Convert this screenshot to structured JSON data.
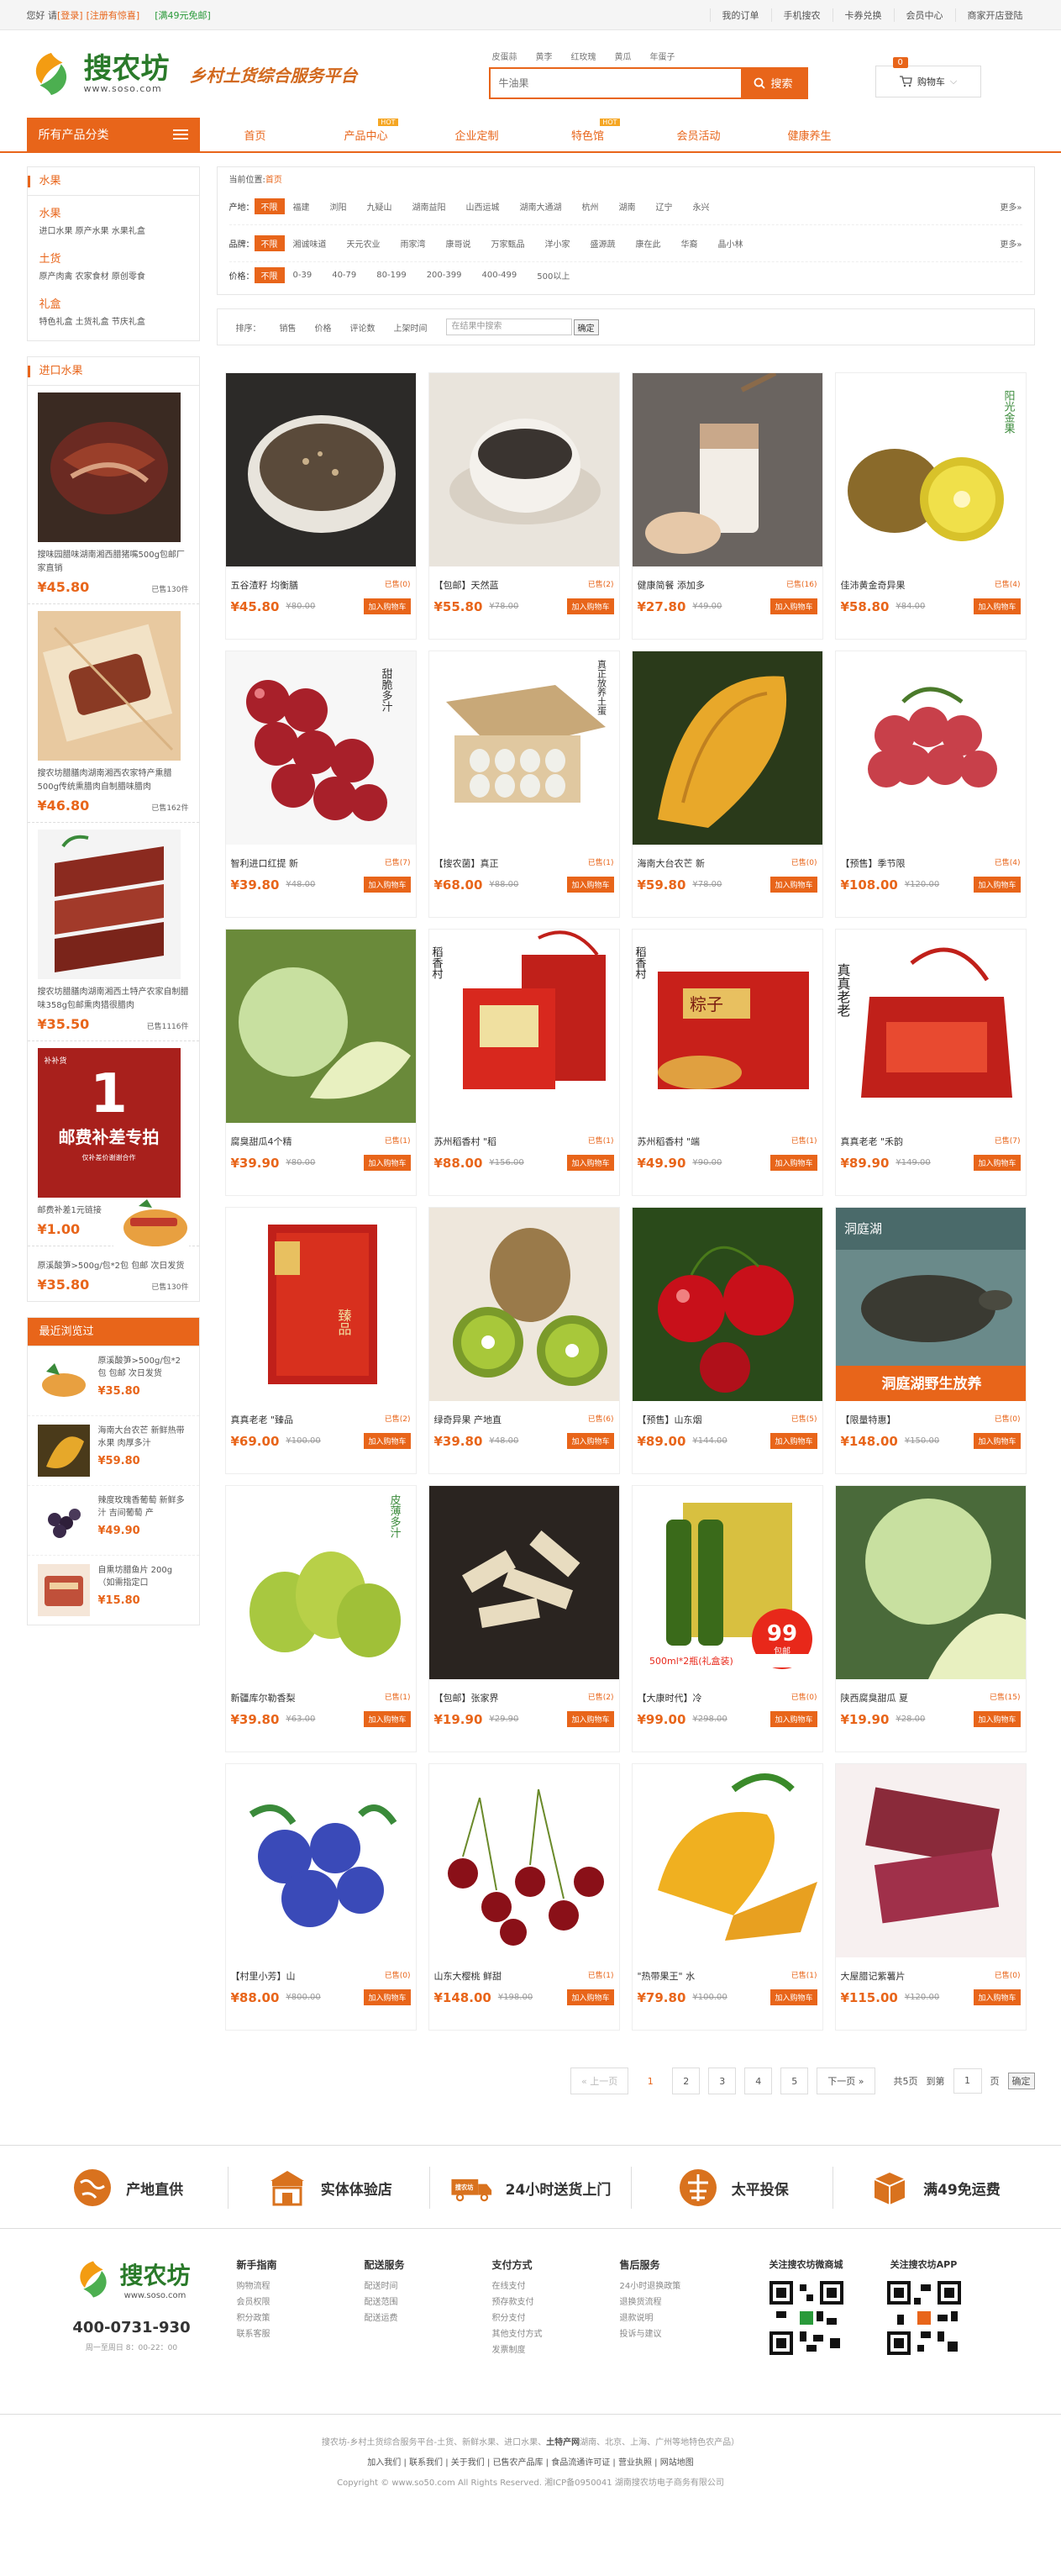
{
  "topbar": {
    "greet": "您好 请",
    "login": "[登录]",
    "reg": "[注册有惊喜]",
    "promo": "[满49元免邮]",
    "links": [
      "我的订单",
      "手机搜农",
      "卡券兑换",
      "会员中心",
      "商家开店登陆"
    ]
  },
  "header": {
    "logo_name": "搜农坊",
    "logo_url": "www.soso.com",
    "slogan": "乡村土货综合服务平台",
    "hot": [
      "皮蛋蒜",
      "黄李",
      "红玫瑰",
      "黄瓜",
      "年蛋子"
    ],
    "search_placeholder": "牛油果",
    "search_btn": "搜索",
    "cart_label": "购物车",
    "cart_count": "0"
  },
  "nav": {
    "cat_head": "所有产品分类",
    "items": [
      {
        "label": "首页",
        "tag": ""
      },
      {
        "label": "产品中心",
        "tag": "HOT"
      },
      {
        "label": "企业定制",
        "tag": ""
      },
      {
        "label": "特色馆",
        "tag": "HOT"
      },
      {
        "label": "会员活动",
        "tag": ""
      },
      {
        "label": "健康养生",
        "tag": ""
      }
    ]
  },
  "side": {
    "cat_title": "水果",
    "groups": [
      {
        "title": "水果",
        "items": "进口水果 原产水果 水果礼盒"
      },
      {
        "title": "土货",
        "items": "原产肉禽 农家食材 原创零食"
      },
      {
        "title": "礼盒",
        "items": "特色礼盒 土货礼盒 节庆礼盒"
      }
    ],
    "imp_title": "进口水果",
    "imp": [
      {
        "name": "搜味园腊味湖南湘西腊猪嘴500g包邮厂家直销",
        "price": "¥45.80",
        "sold": "已售",
        "sold_n": "130件"
      },
      {
        "name": "搜农坊腊膳肉湖南湘西农家特产熏腊500g传统熏腊肉自制腊味腊肉",
        "price": "¥46.80",
        "sold": "已售",
        "sold_n": "162件"
      },
      {
        "name": "搜农坊腊膳肉湖南湘西土特产农家自制腊味358g包邮熏肉猎很腊肉",
        "price": "¥35.50",
        "sold": "已售",
        "sold_n": "1116件"
      },
      {
        "name": "邮费补差1元链接",
        "price": "¥1.00",
        "sold": "",
        "sold_n": ""
      },
      {
        "name": "原溪酸笋>500g/包*2包 包邮 次日发货",
        "price": "¥35.80",
        "sold": "已售",
        "sold_n": "130件"
      }
    ],
    "imp_banner": {
      "big": "1",
      "line": "邮费补差专拍",
      "tag": "补补货",
      "sub": "仅补差价谢谢合作"
    },
    "recent_title": "最近浏览过",
    "recent": [
      {
        "name": "原溪酸笋>500g/包*2包 包邮 次日发货",
        "price": "¥35.80"
      },
      {
        "name": "海南大台农芒 新鲜热带水果 肉厚多汁",
        "price": "¥59.80"
      },
      {
        "name": "辣度玫瑰香葡萄 新鲜多汁 吉间葡萄 产",
        "price": "¥49.90"
      },
      {
        "name": "自熏坊腊鱼片 200g（如需指定口",
        "price": "¥15.80"
      }
    ]
  },
  "filter": {
    "bc_label": "当前位置:",
    "bc_home": "首页",
    "rows": [
      {
        "label": "产地：",
        "all": "不限",
        "opts": [
          "福建",
          "浏阳",
          "九疑山",
          "湖南益阳",
          "山西运城",
          "湖南大通湖",
          "杭州",
          "湖南",
          "辽宁",
          "永兴"
        ],
        "more": "更多»"
      },
      {
        "label": "品牌：",
        "all": "不限",
        "opts": [
          "湘诚味道",
          "天元农业",
          "雨家湾",
          "康哥说",
          "万家甄品",
          "洋小家",
          "盛源蔬",
          "康在此",
          "华裔",
          "晶小林"
        ],
        "more": "更多»"
      },
      {
        "label": "价格：",
        "all": "不限",
        "opts": [
          "0-39",
          "40-79",
          "80-199",
          "200-399",
          "400-499",
          "500以上"
        ],
        "more": ""
      }
    ]
  },
  "sort": {
    "label": "排序：",
    "opts": [
      "销售",
      "价格",
      "评论数",
      "上架时间"
    ],
    "placeholder": "在结果中搜索",
    "btn": "确定"
  },
  "products": [
    {
      "name": "五谷渣籽 均衡膳",
      "sold": "已售",
      "n": "(0)",
      "price": "¥45.80",
      "old": "¥80.00",
      "img": "porridge"
    },
    {
      "name": "【包邮】天然蓝",
      "sold": "已售",
      "n": "(2)",
      "price": "¥55.80",
      "old": "¥78.00",
      "img": "paste"
    },
    {
      "name": "健康简餐 添加多",
      "sold": "已售",
      "n": "(16)",
      "price": "¥27.80",
      "old": "¥49.00",
      "img": "yogurt"
    },
    {
      "name": "佳沛黄金奇异果",
      "sold": "已售",
      "n": "(4)",
      "price": "¥58.80",
      "old": "¥84.00",
      "img": "kiwi-gold"
    },
    {
      "name": "智利进口红提 新",
      "sold": "已售",
      "n": "(7)",
      "price": "¥39.80",
      "old": "¥48.00",
      "img": "grapes"
    },
    {
      "name": "【搜农菌】真正",
      "sold": "已售",
      "n": "(1)",
      "price": "¥68.00",
      "old": "¥88.00",
      "img": "eggs"
    },
    {
      "name": "海南大台农芒 新",
      "sold": "已售",
      "n": "(0)",
      "price": "¥59.80",
      "old": "¥78.00",
      "img": "mango"
    },
    {
      "name": "【预售】季节限",
      "sold": "已售",
      "n": "(4)",
      "price": "¥108.00",
      "old": "¥120.00",
      "img": "lychee"
    },
    {
      "name": "腐臭甜瓜4个精",
      "sold": "已售",
      "n": "(1)",
      "price": "¥39.90",
      "old": "¥80.00",
      "img": "melon"
    },
    {
      "name": "苏州稻香村 \"稻",
      "sold": "已售",
      "n": "(1)",
      "price": "¥88.00",
      "old": "¥156.00",
      "img": "giftbox1"
    },
    {
      "name": "苏州稻香村 \"端",
      "sold": "已售",
      "n": "(1)",
      "price": "¥49.90",
      "old": "¥90.00",
      "img": "giftbox2"
    },
    {
      "name": "真真老老 \"禾韵",
      "sold": "已售",
      "n": "(7)",
      "price": "¥89.90",
      "old": "¥149.00",
      "img": "giftbag"
    },
    {
      "name": "真真老老 \"臻品",
      "sold": "已售",
      "n": "(2)",
      "price": "¥69.00",
      "old": "¥100.00",
      "img": "giftbox3"
    },
    {
      "name": "绿奇异果 产地直",
      "sold": "已售",
      "n": "(6)",
      "price": "¥39.80",
      "old": "¥48.00",
      "img": "kiwi-green"
    },
    {
      "name": "【预售】山东烟",
      "sold": "已售",
      "n": "(5)",
      "price": "¥89.00",
      "old": "¥144.00",
      "img": "cherry"
    },
    {
      "name": "【限量特惠】",
      "sold": "已售",
      "n": "(0)",
      "price": "¥148.00",
      "old": "¥150.00",
      "img": "turtle"
    },
    {
      "name": "新疆库尔勒香梨",
      "sold": "已售",
      "n": "(1)",
      "price": "¥39.80",
      "old": "¥63.00",
      "img": "pear"
    },
    {
      "name": "【包邮】张家界",
      "sold": "已售",
      "n": "(2)",
      "price": "¥19.90",
      "old": "¥29.90",
      "img": "bamboo"
    },
    {
      "name": "【大康时代】冷",
      "sold": "已售",
      "n": "(0)",
      "price": "¥99.00",
      "old": "¥298.00",
      "img": "oil"
    },
    {
      "name": "陕西腐臭甜瓜 夏",
      "sold": "已售",
      "n": "(15)",
      "price": "¥19.90",
      "old": "¥28.00",
      "img": "melon2"
    },
    {
      "name": "【村里小芳】山",
      "sold": "已售",
      "n": "(0)",
      "price": "¥88.00",
      "old": "¥800.00",
      "img": "blueberry"
    },
    {
      "name": "山东大樱桃 鲜甜",
      "sold": "已售",
      "n": "(1)",
      "price": "¥148.00",
      "old": "¥198.00",
      "img": "cherry2"
    },
    {
      "name": "\"热带果王\" 水",
      "sold": "已售",
      "n": "(1)",
      "price": "¥79.80",
      "old": "¥100.00",
      "img": "mango2"
    },
    {
      "name": "大屋腊记紫薯片",
      "sold": "已售",
      "n": "(0)",
      "price": "¥115.00",
      "old": "¥120.00",
      "img": "jerky"
    }
  ],
  "card_add": "加入购物车",
  "img_text": {
    "kiwi_gold": "阳光金果",
    "grapes": "甜脆多汁",
    "eggs": "真正放养土蛋",
    "giftbox": "稻香村",
    "giftbox_zi": "粽子",
    "giftbag": "真真老老",
    "giftbox3": "臻品",
    "pear": "皮薄多汁",
    "oil": "500ml*2瓶(礼盒装)",
    "oil_badge": "99",
    "oil_badge_sub": "包邮",
    "turtle_top": "洞庭湖",
    "turtle": "洞庭湖野生放养"
  },
  "pager": {
    "prev": "« 上一页",
    "pages": [
      "1",
      "2",
      "3",
      "4",
      "5"
    ],
    "next": "下一页 »",
    "total": "共5页",
    "goto": "到第",
    "page_val": "1",
    "unit": "页",
    "ok": "确定"
  },
  "service": [
    "产地直供",
    "实体体验店",
    "24小时送货上门",
    "太平投保",
    "满49免运费"
  ],
  "service_truck_text": "搜农坊",
  "footer": {
    "phone": "400-0731-930",
    "hours": "周一至周日 8：00-22：00",
    "cols": [
      {
        "title": "新手指南",
        "items": [
          "购物流程",
          "会员权限",
          "积分政策",
          "联系客服"
        ]
      },
      {
        "title": "配送服务",
        "items": [
          "配送时间",
          "配送范围",
          "配送运费"
        ]
      },
      {
        "title": "支付方式",
        "items": [
          "在线支付",
          "预存款支付",
          "积分支付",
          "其他支付方式",
          "发票制度"
        ]
      },
      {
        "title": "售后服务",
        "items": [
          "24小时退换政策",
          "退换货流程",
          "退款说明",
          "投诉与建议"
        ]
      }
    ],
    "qr1": "关注搜农坊微商城",
    "qr2": "关注搜农坊APP",
    "desc1": "搜农坊-乡村土货综合服务平台-土货、新鲜水果、进口水果、",
    "desc_strong": "土特产网",
    "desc2": "湖南、北京、上海、广州等地特色农产品）",
    "links": [
      "加入我们",
      "联系我们",
      "关于我们",
      "已售农产品库",
      "食品流通许可证",
      "营业执照",
      "网站地图"
    ],
    "copyright": "Copyright © www.so50.com All Rights Reserved. 湘ICP备0950041 湖南搜农坊电子商务有限公司"
  }
}
